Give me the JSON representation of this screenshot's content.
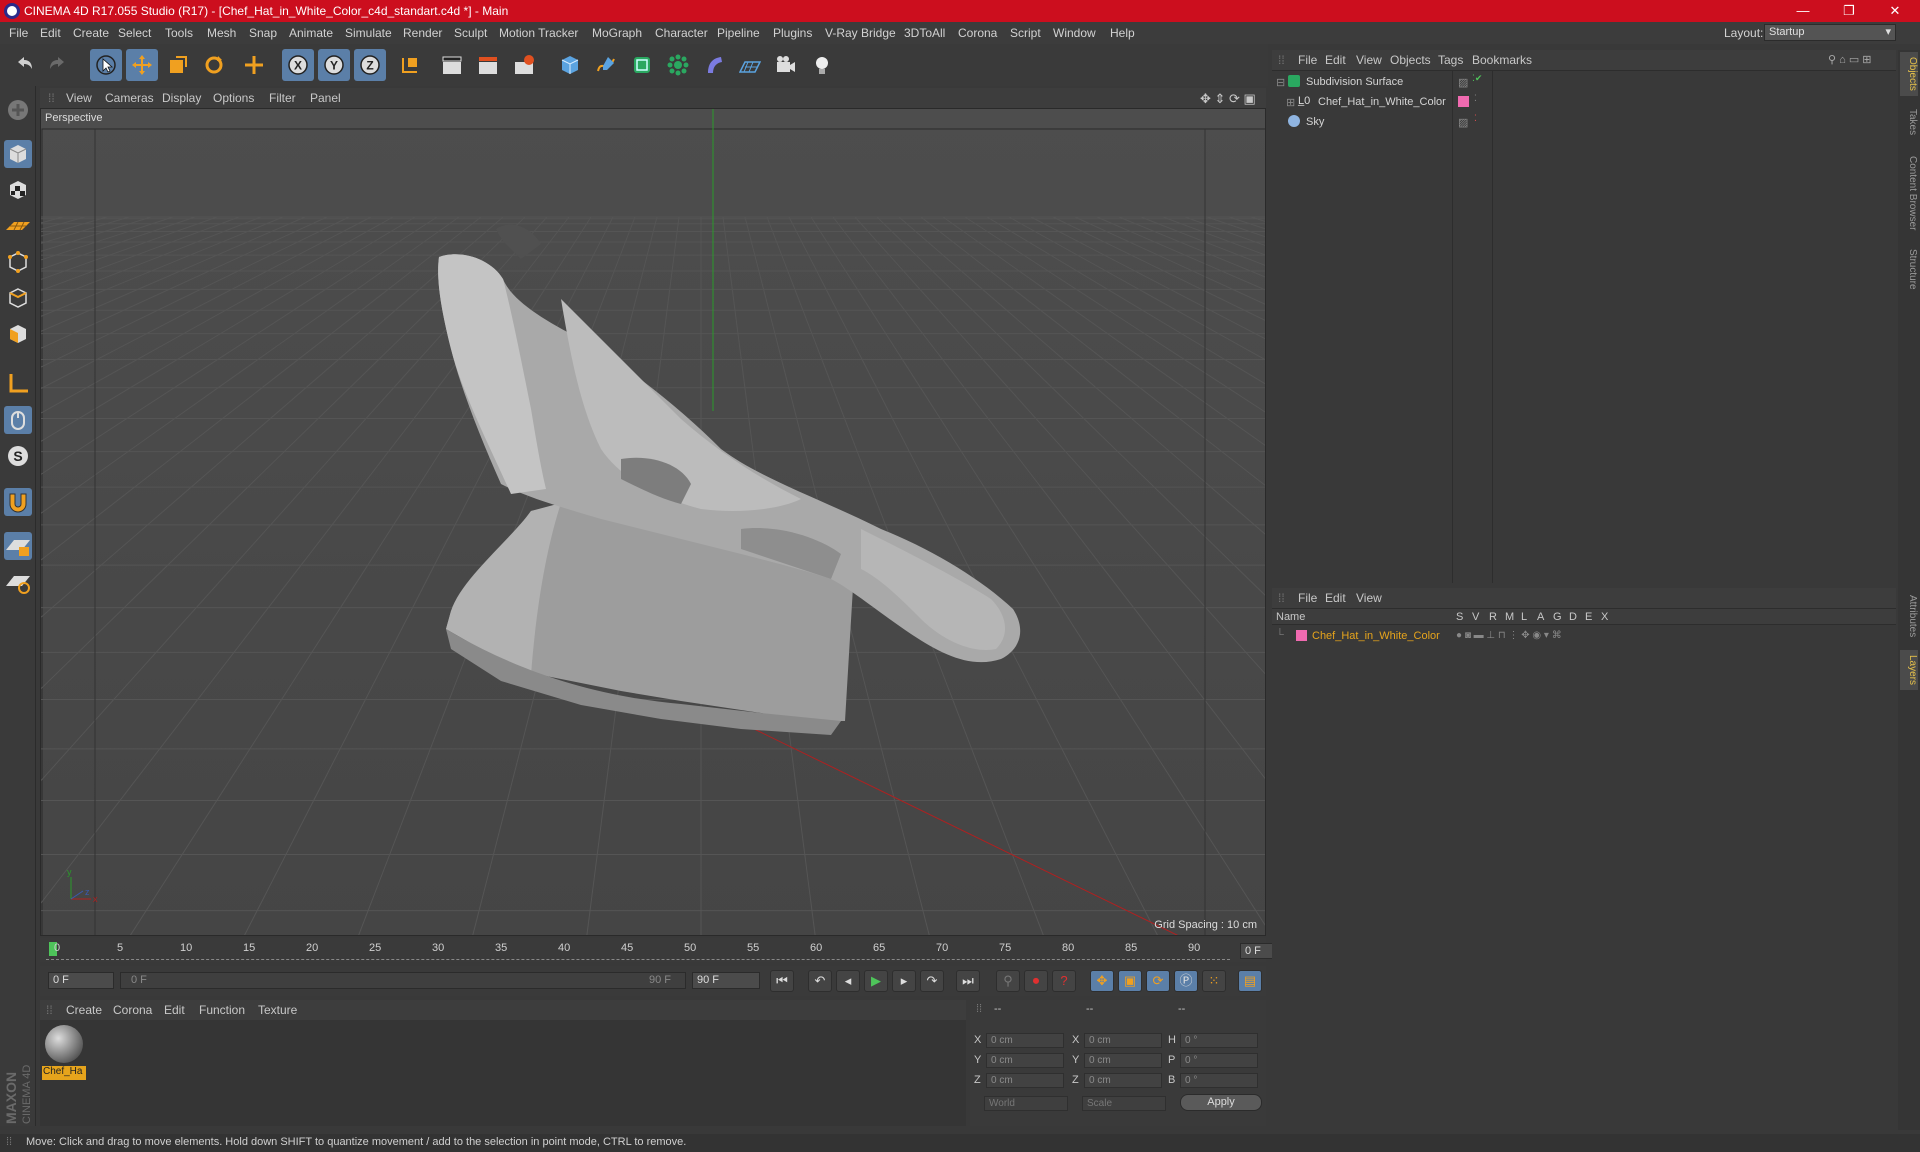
{
  "window": {
    "title": "CINEMA 4D R17.055 Studio (R17) - [Chef_Hat_in_White_Color_c4d_standart.c4d *] - Main",
    "minimize": "—",
    "restore": "❐",
    "close": "✕"
  },
  "menubar": {
    "items": [
      "File",
      "Edit",
      "Create",
      "Select",
      "Tools",
      "Mesh",
      "Snap",
      "Animate",
      "Simulate",
      "Render",
      "Sculpt",
      "Motion Tracker",
      "MoGraph",
      "Character",
      "Pipeline",
      "Plugins",
      "V-Ray Bridge",
      "3DToAll",
      "Corona",
      "Script",
      "Window",
      "Help"
    ],
    "layout_label": "Layout:",
    "layout_value": "Startup"
  },
  "viewport": {
    "menu": [
      "View",
      "Cameras",
      "Display",
      "Options",
      "Filter",
      "Panel"
    ],
    "label": "Perspective",
    "grid_spacing": "Grid Spacing : 10 cm"
  },
  "timeline": {
    "ticks": [
      "0",
      "5",
      "10",
      "15",
      "20",
      "25",
      "30",
      "35",
      "40",
      "45",
      "50",
      "55",
      "60",
      "65",
      "70",
      "75",
      "80",
      "85",
      "90"
    ],
    "current_frame": "0 F"
  },
  "playback": {
    "start_field": "0 F",
    "range_start": "0 F",
    "range_end": "90 F",
    "end_field": "90 F"
  },
  "material_panel": {
    "menu": [
      "Create",
      "Corona",
      "Edit",
      "Function",
      "Texture"
    ],
    "material_name": "Chef_Ha"
  },
  "coords": {
    "headers": [
      "--",
      "--",
      "--"
    ],
    "rows": [
      {
        "l1": "X",
        "v1": "0 cm",
        "l2": "X",
        "v2": "0 cm",
        "l3": "H",
        "v3": "0 °"
      },
      {
        "l1": "Y",
        "v1": "0 cm",
        "l2": "Y",
        "v2": "0 cm",
        "l3": "P",
        "v3": "0 °"
      },
      {
        "l1": "Z",
        "v1": "0 cm",
        "l2": "Z",
        "v2": "0 cm",
        "l3": "B",
        "v3": "0 °"
      }
    ],
    "world": "World",
    "scale": "Scale",
    "apply": "Apply"
  },
  "object_manager": {
    "menu": [
      "File",
      "Edit",
      "View",
      "Objects",
      "Tags",
      "Bookmarks"
    ],
    "objects": [
      "Subdivision Surface",
      "Chef_Hat_in_White_Color",
      "Sky"
    ]
  },
  "layer_manager": {
    "menu": [
      "File",
      "Edit",
      "View"
    ],
    "columns": [
      "Name",
      "S",
      "V",
      "R",
      "M",
      "L",
      "A",
      "G",
      "D",
      "E",
      "X"
    ],
    "layer_name": "Chef_Hat_in_White_Color"
  },
  "right_tabs": [
    "Objects",
    "Takes",
    "Content Browser",
    "Structure",
    "Attributes",
    "Layers"
  ],
  "status": "Move: Click and drag to move elements. Hold down SHIFT to quantize movement / add to the selection in point mode, CTRL to remove.",
  "brand": "MAXON CINEMA 4D",
  "colors": {
    "title_bar": "#cc0e1e",
    "selected_button": "#5b7fa8",
    "layer_color": "#f06ab0",
    "layer_name_color": "#e6a41c",
    "axis_x": "#b02020",
    "axis_y": "#2a9a2a"
  }
}
